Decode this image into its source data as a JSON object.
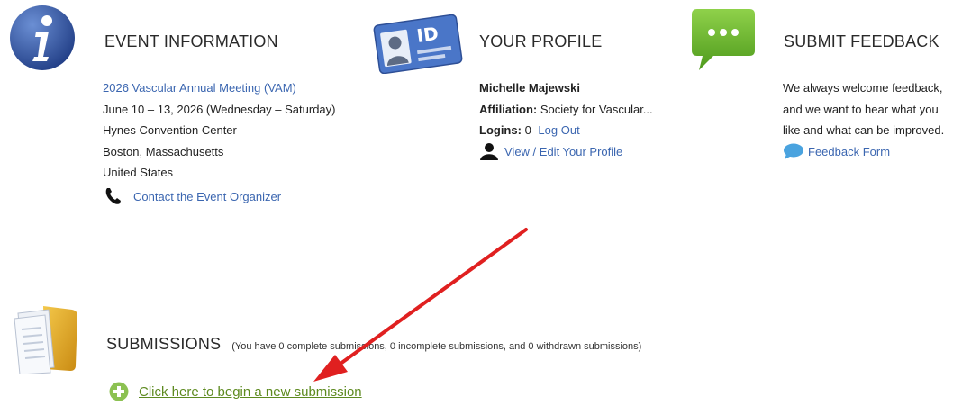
{
  "event": {
    "title": "EVENT INFORMATION",
    "name": "2026 Vascular Annual Meeting (VAM)",
    "dates": "June 10 – 13, 2026 (Wednesday – Saturday)",
    "venue": "Hynes Convention Center",
    "city": "Boston, Massachusetts",
    "country": "United States",
    "contact_label": "Contact the Event Organizer",
    "icon": "info-icon"
  },
  "profile": {
    "title": "YOUR PROFILE",
    "name": "Michelle Majewski",
    "affiliation_label": "Affiliation:",
    "affiliation_value": "Society for Vascular...",
    "logins_label": "Logins:",
    "logins_value": "0",
    "logout_label": "Log Out",
    "view_edit_label": "View / Edit Your Profile",
    "id_badge_text": "ID",
    "icon": "id-card-icon"
  },
  "feedback": {
    "title": "SUBMIT FEEDBACK",
    "lines": [
      "We always welcome feedback,",
      "and we want to hear what you",
      "like and what can be improved."
    ],
    "form_label": "Feedback Form",
    "icon": "chat-bubble-icon"
  },
  "submissions": {
    "title": "SUBMISSIONS",
    "note": "(You have 0 complete submissions, 0 incomplete submissions, and 0 withdrawn submissions)",
    "new_label": "Click here to begin a new submission",
    "icon": "folder-icon"
  },
  "colors": {
    "link_blue": "#3b66b0",
    "green_link": "#5d8a1f",
    "annotation_arrow": "#e02020"
  }
}
